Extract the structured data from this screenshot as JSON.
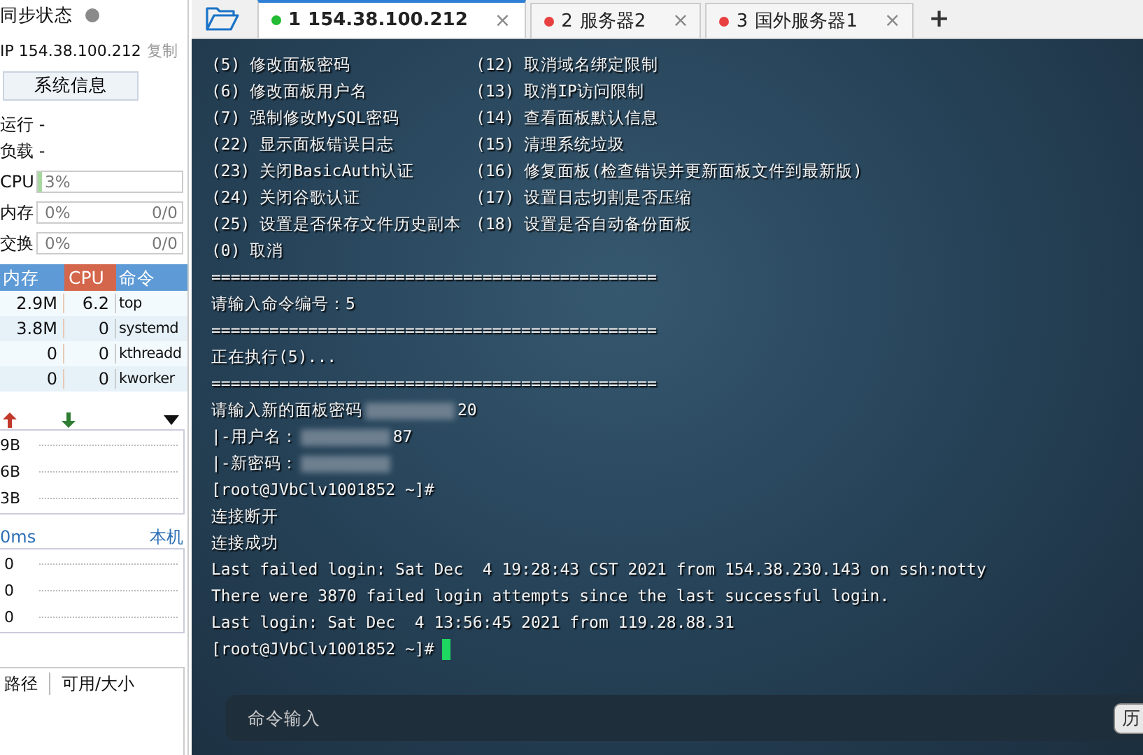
{
  "sidebar": {
    "sync": {
      "label": "同步状态",
      "online": false
    },
    "ip": {
      "text": "IP 154.38.100.212",
      "copy": "复制"
    },
    "sysinfo_button": "系统信息",
    "stats": [
      "运行 -",
      "负载 -"
    ],
    "meters": [
      {
        "label": "CPU",
        "percent": "3%",
        "level": 0.03
      },
      {
        "label": "内存",
        "percent": "0%",
        "amount": "0/0"
      },
      {
        "label": "交换",
        "percent": "0%",
        "amount": "0/0"
      }
    ],
    "processes": {
      "columns": [
        "内存",
        "CPU",
        "命令"
      ],
      "rows": [
        {
          "mem": "2.9M",
          "cpu": "6.2",
          "cmd": "top"
        },
        {
          "mem": "3.8M",
          "cpu": "0",
          "cmd": "systemd"
        },
        {
          "mem": "0",
          "cpu": "0",
          "cmd": "kthreadd"
        },
        {
          "mem": "0",
          "cpu": "0",
          "cmd": "kworker"
        }
      ]
    },
    "network": {
      "ticks": [
        "9B",
        "6B",
        "3B"
      ]
    },
    "latency": {
      "value": "0ms",
      "host": "本机",
      "ticks": [
        "0",
        "0",
        "0"
      ]
    },
    "disks": {
      "columns": [
        "路径",
        "可用/大小"
      ]
    }
  },
  "tabs": [
    {
      "number": "1",
      "label": "154.38.100.212",
      "selected": true,
      "connected": true,
      "close": "×"
    },
    {
      "number": "2",
      "label": "服务器2",
      "selected": false,
      "connected": false,
      "close": "×"
    },
    {
      "number": "3",
      "label": "国外服务器1",
      "selected": false,
      "connected": false,
      "close": "×"
    }
  ],
  "add_tab": "+",
  "terminal": {
    "lines": [
      {
        "kind": "menu",
        "left": "(5) 修改面板密码",
        "right": "(12) 取消域名绑定限制"
      },
      {
        "kind": "menu",
        "left": "(6) 修改面板用户名",
        "right": "(13) 取消IP访问限制"
      },
      {
        "kind": "menu",
        "left": "(7) 强制修改MySQL密码",
        "right": "(14) 查看面板默认信息"
      },
      {
        "kind": "menu",
        "left": "(22) 显示面板错误日志",
        "right": "(15) 清理系统垃圾"
      },
      {
        "kind": "menu",
        "left": "(23) 关闭BasicAuth认证",
        "right": "(16) 修复面板(检查错误并更新面板文件到最新版)"
      },
      {
        "kind": "menu",
        "left": "(24) 关闭谷歌认证",
        "right": "(17) 设置日志切割是否压缩"
      },
      {
        "kind": "menu",
        "left": "(25) 设置是否保存文件历史副本",
        "right": "(18) 设置是否自动备份面板"
      },
      {
        "kind": "text",
        "text": "(0) 取消"
      },
      {
        "kind": "text",
        "text": "=============================================="
      },
      {
        "kind": "text",
        "text": "请输入命令编号：5"
      },
      {
        "kind": "text",
        "text": "=============================================="
      },
      {
        "kind": "text",
        "text": "正在执行(5)..."
      },
      {
        "kind": "text",
        "text": "=============================================="
      },
      {
        "kind": "redacted",
        "before": "请输入新的面板密码",
        "after": "20"
      },
      {
        "kind": "redacted",
        "before": "|-用户名：",
        "after": "87"
      },
      {
        "kind": "redacted",
        "before": "|-新密码："
      },
      {
        "kind": "text",
        "text": "[root@JVbClv1001852 ~]#"
      },
      {
        "kind": "text",
        "text": "连接断开"
      },
      {
        "kind": "text",
        "text": "连接成功"
      },
      {
        "kind": "text",
        "text": "Last failed login: Sat Dec  4 19:28:43 CST 2021 from 154.38.230.143 on ssh:notty"
      },
      {
        "kind": "text",
        "text": "There were 3870 failed login attempts since the last successful login."
      },
      {
        "kind": "text",
        "text": "Last login: Sat Dec  4 13:56:45 2021 from 119.28.88.31"
      },
      {
        "kind": "prompt",
        "text": "[root@JVbClv1001852 ~]#"
      }
    ],
    "command_input": {
      "placeholder": "命令输入",
      "history_button": "历"
    }
  }
}
